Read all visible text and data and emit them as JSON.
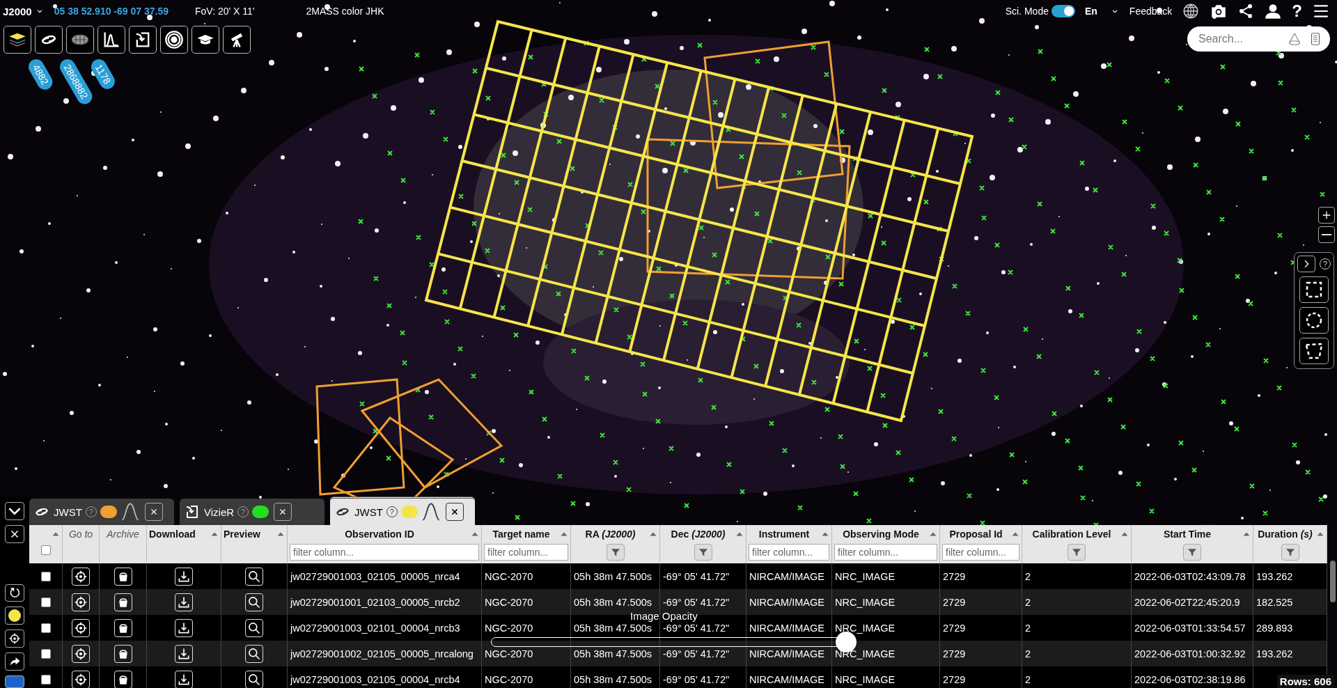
{
  "top_bar": {
    "frame": "J2000",
    "coordinates": "05 38 52.910 -69 07 37.59",
    "fov": "FoV: 20' X 11'",
    "survey": "2MASS color JHK",
    "sci_mode": {
      "label": "Sci. Mode",
      "on": true
    },
    "language": "En",
    "feedback": "Feedback",
    "help": "?"
  },
  "search": {
    "placeholder": "Search..."
  },
  "toolbar": [
    {
      "kind": "layers"
    },
    {
      "kind": "galaxy",
      "badge": "4882"
    },
    {
      "kind": "catalog",
      "badge": "2868882"
    },
    {
      "kind": "spectrum",
      "badge": "1178"
    },
    {
      "kind": "import"
    },
    {
      "kind": "rings"
    },
    {
      "kind": "education"
    },
    {
      "kind": "telescope"
    }
  ],
  "selection_tools": {
    "help": "?",
    "tools": [
      {
        "kind": "box"
      },
      {
        "kind": "circle"
      },
      {
        "kind": "polygon"
      }
    ]
  },
  "opacity": {
    "label": "Image Opacity",
    "level": 1
  },
  "side_tools": [
    {
      "kind": "collapse"
    },
    {
      "kind": "close"
    },
    {
      "kind": "refresh"
    },
    {
      "kind": "color",
      "color": "#f2e54a"
    },
    {
      "kind": "target"
    },
    {
      "kind": "share"
    },
    {
      "kind": "more"
    }
  ],
  "tabs": [
    {
      "label": "JWST",
      "kind": "galaxy",
      "help": "?",
      "color": "#f0a030",
      "wave": true,
      "selected": false
    },
    {
      "label": "VizieR",
      "kind": "import",
      "help": "?",
      "color": "#22dd22",
      "wave": false,
      "selected": false
    },
    {
      "label": "JWST",
      "kind": "galaxy",
      "help": "?",
      "color": "#f2e54a",
      "wave": true,
      "selected": true
    }
  ],
  "table": {
    "select_all": {
      "checked": false
    },
    "columns": [
      {
        "kind": "select",
        "sortable": true
      },
      {
        "label": "Go to",
        "kind": "goto",
        "sortable": false
      },
      {
        "label": "Archive",
        "kind": "archive",
        "sortable": false
      },
      {
        "label": "Download",
        "kind": "download",
        "sortable": true
      },
      {
        "label": "Preview",
        "kind": "preview",
        "sortable": true
      },
      {
        "label": "Observation ID",
        "kind": "field-filter",
        "placeholder": "filter column...",
        "sortable": true
      },
      {
        "label": "Target name",
        "kind": "field-filter",
        "placeholder": "filter column...",
        "sortable": true
      },
      {
        "label": "RA *(J2000)*",
        "kind": "button-filter",
        "sortable": true
      },
      {
        "label": "Dec *(J2000)*",
        "kind": "button-filter",
        "sortable": true
      },
      {
        "label": "Instrument",
        "kind": "field-filter",
        "placeholder": "filter column...",
        "sortable": true
      },
      {
        "label": "Observing Mode",
        "kind": "field-filter",
        "placeholder": "filter column...",
        "sortable": true
      },
      {
        "label": "Proposal Id",
        "kind": "field-filter",
        "placeholder": "filter column...",
        "sortable": true
      },
      {
        "label": "Calibration Level",
        "kind": "button-filter",
        "sortable": true
      },
      {
        "label": "Start Time",
        "kind": "button-filter",
        "sortable": true
      },
      {
        "label": "Duration *(s)*",
        "kind": "button-filter",
        "sortable": true
      }
    ],
    "rows": [
      {
        "checked": false,
        "cells": [
          "",
          "",
          "",
          "",
          "",
          "jw02729001003_02105_00005_nrca4",
          "NGC-2070",
          "05h 38m 47.500s",
          "-69° 05' 41.72\"",
          "NIRCAM/IMAGE",
          "NRC_IMAGE",
          "2729",
          "2",
          "2022-06-03T02:43:09.78",
          "193.262"
        ]
      },
      {
        "checked": false,
        "cells": [
          "",
          "",
          "",
          "",
          "",
          "jw02729001001_02103_00005_nrcb2",
          "NGC-2070",
          "05h 38m 47.500s",
          "-69° 05' 41.72\"",
          "NIRCAM/IMAGE",
          "NRC_IMAGE",
          "2729",
          "2",
          "2022-06-02T22:45:20.9",
          "182.525"
        ]
      },
      {
        "checked": false,
        "cells": [
          "",
          "",
          "",
          "",
          "",
          "jw02729001003_02101_00004_nrcb3",
          "NGC-2070",
          "05h 38m 47.500s",
          "-69° 05' 41.72\"",
          "NIRCAM/IMAGE",
          "NRC_IMAGE",
          "2729",
          "2",
          "2022-06-03T01:33:54.57",
          "289.893"
        ]
      },
      {
        "checked": false,
        "cells": [
          "",
          "",
          "",
          "",
          "",
          "jw02729001002_02105_00005_nrcalong",
          "NGC-2070",
          "05h 38m 47.500s",
          "-69° 05' 41.72\"",
          "NIRCAM/IMAGE",
          "NRC_IMAGE",
          "2729",
          "2",
          "2022-06-03T01:00:32.92",
          "193.262"
        ]
      },
      {
        "checked": false,
        "cells": [
          "",
          "",
          "",
          "",
          "",
          "jw02729001003_02105_00004_nrcb4",
          "NGC-2070",
          "05h 38m 47.500s",
          "-69° 05' 41.72\"",
          "NIRCAM/IMAGE",
          "NRC_IMAGE",
          "2729",
          "2",
          "2022-06-03T02:38:19.86"
        ]
      }
    ],
    "row_count": "Rows: 606"
  }
}
